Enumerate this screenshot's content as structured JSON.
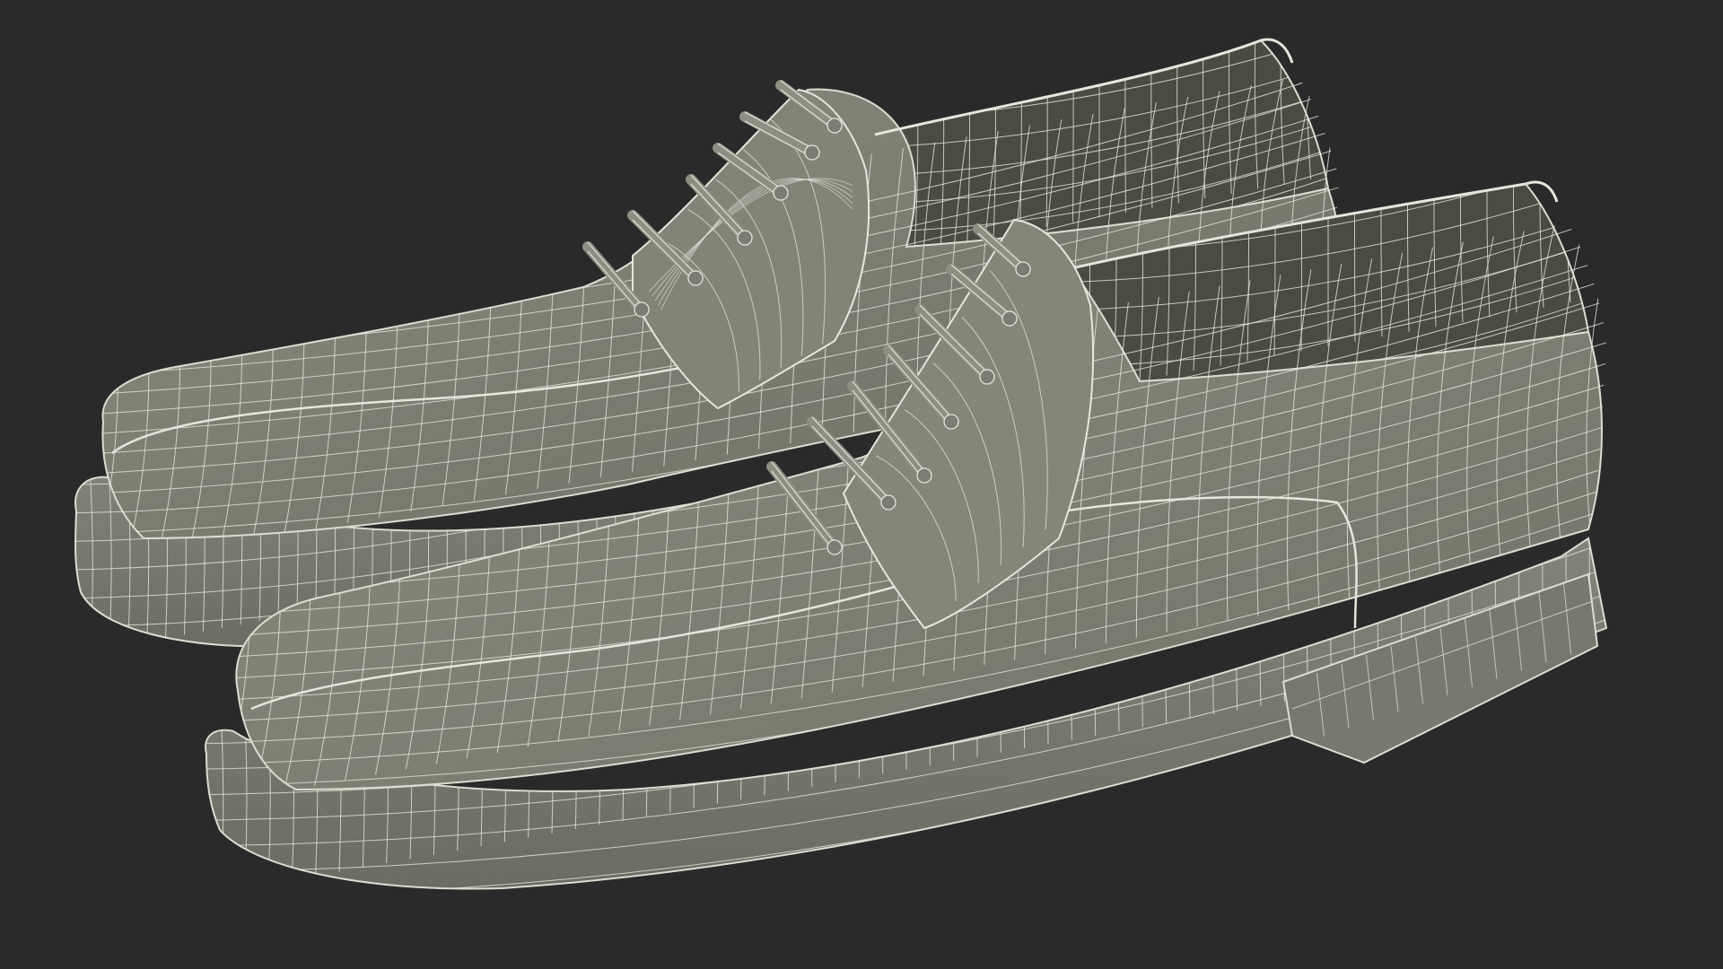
{
  "scene": {
    "subject": "wireframe-derby-shoes-pair",
    "colors": {
      "background": "#2a2a2a",
      "surface": "#7d7d72",
      "surface_dark": "#6a6a60",
      "surface_light": "#8c8c80",
      "interior": "#4a4a42",
      "wire": "#e6e6dc",
      "sole": "#7a7a70"
    }
  }
}
